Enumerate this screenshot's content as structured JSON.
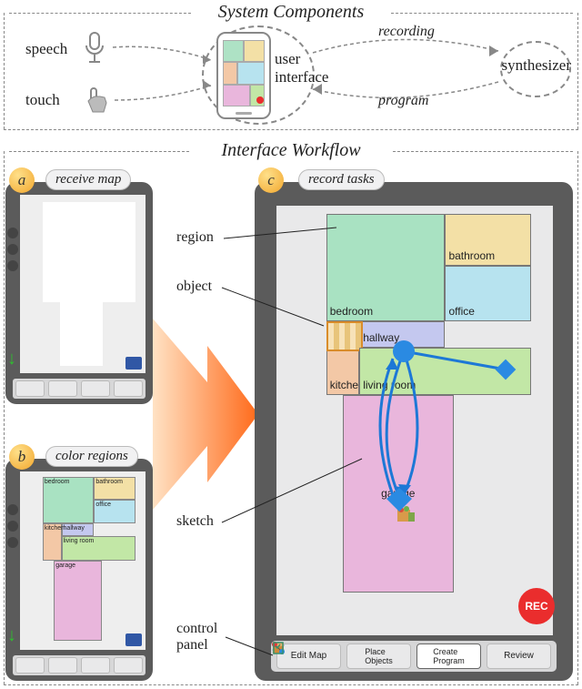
{
  "sections": {
    "components": "System Components",
    "workflow": "Interface Workflow"
  },
  "components": {
    "speech": "speech",
    "touch": "touch",
    "ui": "user\ninterface",
    "synth": "synthesizer",
    "edges": {
      "recording": "recording",
      "program": "program"
    }
  },
  "workflow": {
    "a": {
      "letter": "a",
      "title": "receive map"
    },
    "b": {
      "letter": "b",
      "title": "color regions"
    },
    "c": {
      "letter": "c",
      "title": "record tasks"
    },
    "annotations": {
      "region": "region",
      "object": "object",
      "sketch": "sketch",
      "control": "control\npanel"
    },
    "rooms": {
      "bedroom": "bedroom",
      "bathroom": "bathroom",
      "office": "office",
      "hallway": "hallway",
      "kitchen": "kitchen",
      "living": "living room",
      "garage": "garage"
    },
    "rec": "REC",
    "toolbar": {
      "edit": "Edit Map",
      "place": "Place\nObjects",
      "create": "Create\nProgram",
      "review": "Review"
    }
  },
  "icons": {
    "mic": "mic-icon",
    "touch": "touch-icon",
    "phone": "phone-icon",
    "shield": "shield-icon"
  }
}
